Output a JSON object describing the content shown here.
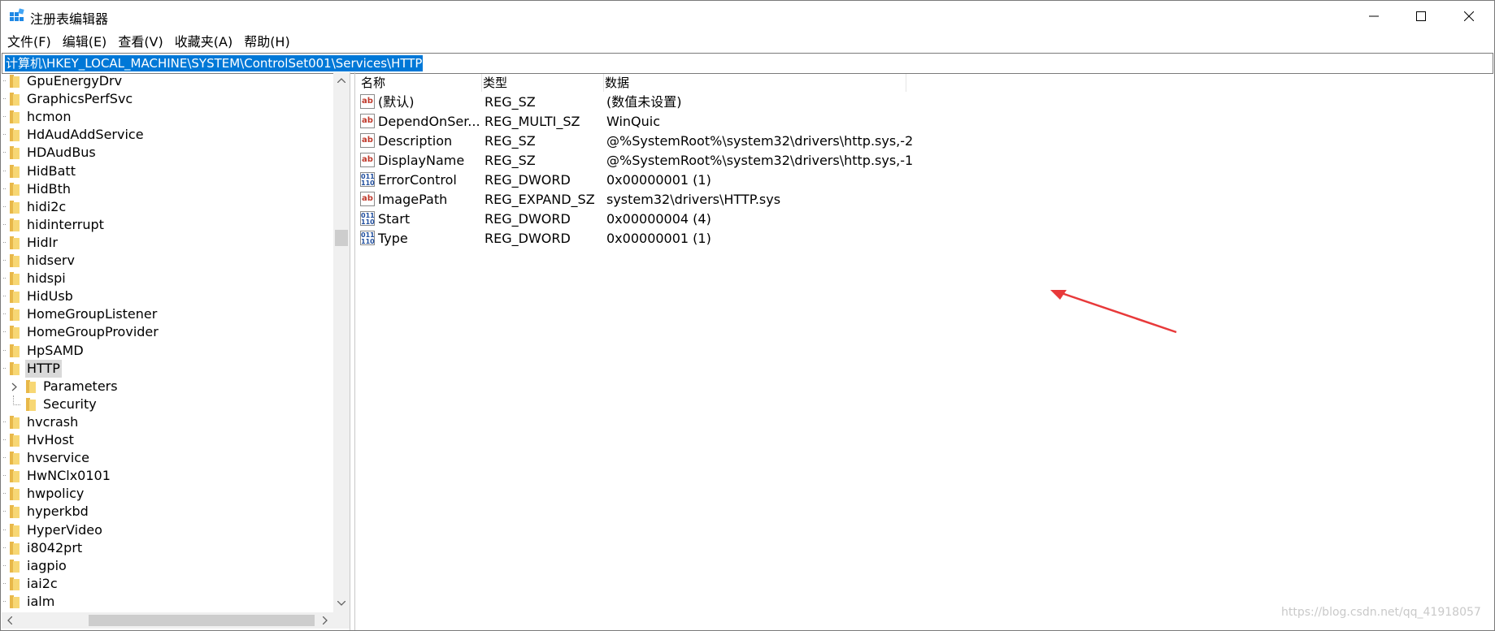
{
  "window": {
    "title": "注册表编辑器",
    "minimize_icon": "minimize-icon",
    "maximize_icon": "maximize-icon",
    "close_icon": "close-icon"
  },
  "menu": [
    "文件(F)",
    "编辑(E)",
    "查看(V)",
    "收藏夹(A)",
    "帮助(H)"
  ],
  "address": "计算机\\HKEY_LOCAL_MACHINE\\SYSTEM\\ControlSet001\\Services\\HTTP",
  "tree": {
    "items": [
      {
        "label": "GpuEnergyDrv"
      },
      {
        "label": "GraphicsPerfSvc"
      },
      {
        "label": "hcmon"
      },
      {
        "label": "HdAudAddService"
      },
      {
        "label": "HDAudBus"
      },
      {
        "label": "HidBatt"
      },
      {
        "label": "HidBth"
      },
      {
        "label": "hidi2c"
      },
      {
        "label": "hidinterrupt"
      },
      {
        "label": "HidIr"
      },
      {
        "label": "hidserv"
      },
      {
        "label": "hidspi"
      },
      {
        "label": "HidUsb"
      },
      {
        "label": "HomeGroupListener"
      },
      {
        "label": "HomeGroupProvider"
      },
      {
        "label": "HpSAMD"
      },
      {
        "label": "HTTP",
        "selected": true
      },
      {
        "label": "Parameters",
        "child": true,
        "expandable": true
      },
      {
        "label": "Security",
        "child": true,
        "last_child": true
      },
      {
        "label": "hvcrash"
      },
      {
        "label": "HvHost"
      },
      {
        "label": "hvservice"
      },
      {
        "label": "HwNClx0101"
      },
      {
        "label": "hwpolicy"
      },
      {
        "label": "hyperkbd"
      },
      {
        "label": "HyperVideo"
      },
      {
        "label": "i8042prt"
      },
      {
        "label": "iagpio"
      },
      {
        "label": "iai2c"
      },
      {
        "label": "ialm"
      }
    ]
  },
  "values": {
    "headers": {
      "name": "名称",
      "type": "类型",
      "data": "数据"
    },
    "rows": [
      {
        "icon": "string-value-icon",
        "kind": "str",
        "name": "(默认)",
        "type": "REG_SZ",
        "data": "(数值未设置)"
      },
      {
        "icon": "string-value-icon",
        "kind": "str",
        "name": "DependOnSer...",
        "type": "REG_MULTI_SZ",
        "data": "WinQuic"
      },
      {
        "icon": "string-value-icon",
        "kind": "str",
        "name": "Description",
        "type": "REG_SZ",
        "data": "@%SystemRoot%\\system32\\drivers\\http.sys,-2"
      },
      {
        "icon": "string-value-icon",
        "kind": "str",
        "name": "DisplayName",
        "type": "REG_SZ",
        "data": "@%SystemRoot%\\system32\\drivers\\http.sys,-1"
      },
      {
        "icon": "binary-value-icon",
        "kind": "bin",
        "name": "ErrorControl",
        "type": "REG_DWORD",
        "data": "0x00000001 (1)"
      },
      {
        "icon": "string-value-icon",
        "kind": "str",
        "name": "ImagePath",
        "type": "REG_EXPAND_SZ",
        "data": "system32\\drivers\\HTTP.sys"
      },
      {
        "icon": "binary-value-icon",
        "kind": "bin",
        "name": "Start",
        "type": "REG_DWORD",
        "data": "0x00000004 (4)"
      },
      {
        "icon": "binary-value-icon",
        "kind": "bin",
        "name": "Type",
        "type": "REG_DWORD",
        "data": "0x00000001 (1)"
      }
    ]
  },
  "annotation": {
    "color": "#e8393a",
    "icon": "red-arrow-annotation"
  },
  "watermark": "https://blog.csdn.net/qq_41918057",
  "colors": {
    "selection": "#0078d7",
    "folder": "#f7d774"
  }
}
